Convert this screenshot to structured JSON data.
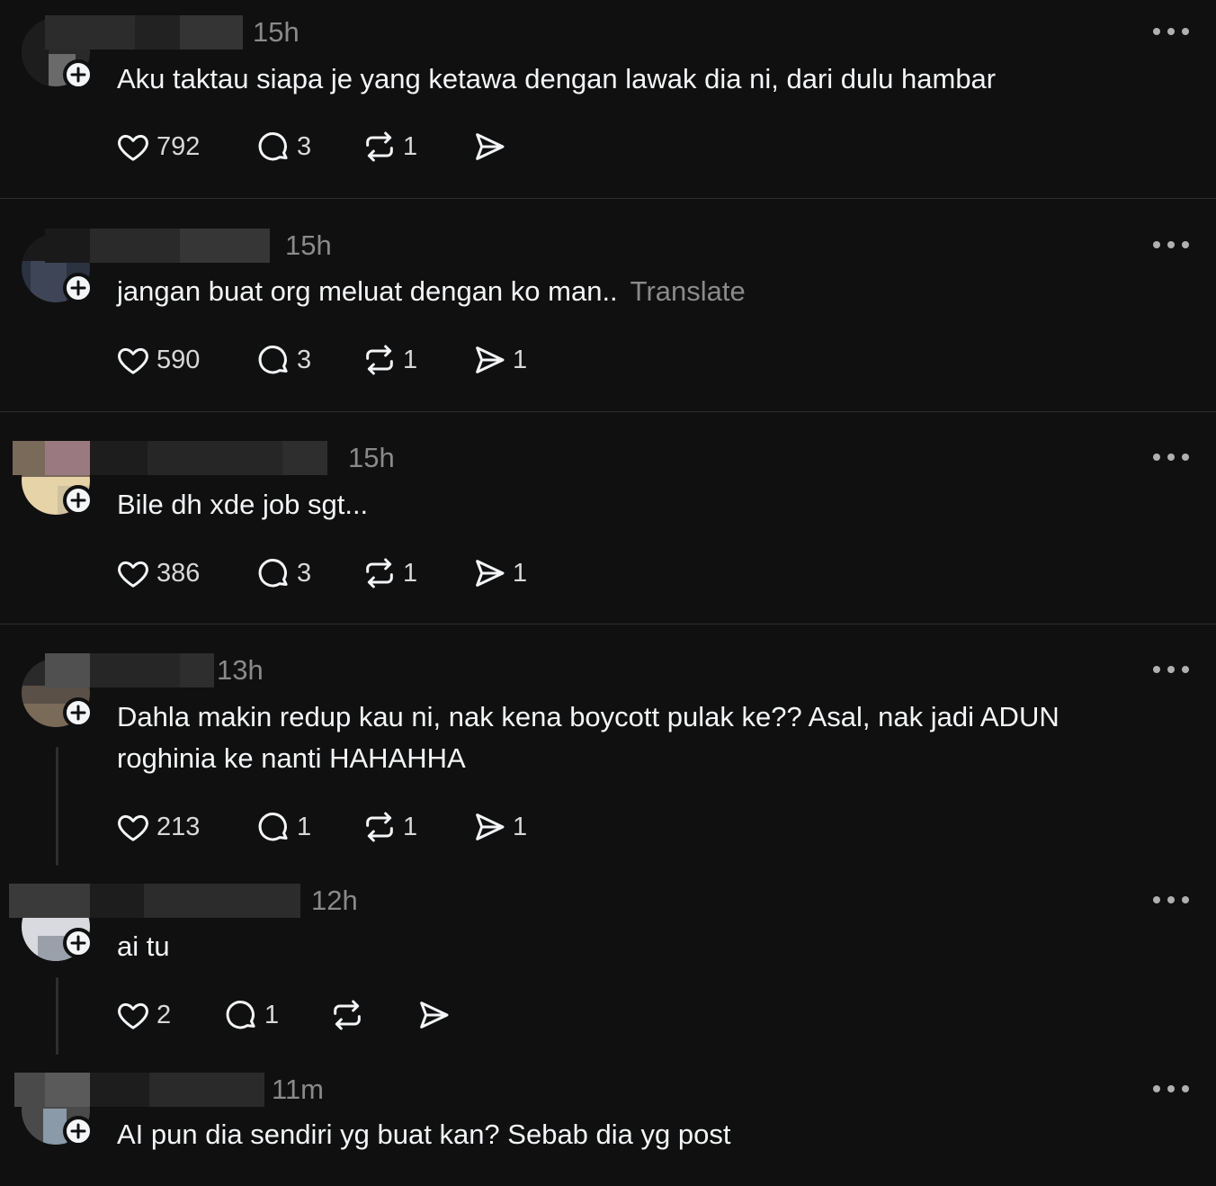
{
  "posts": [
    {
      "time": "15h",
      "text": "Aku taktau siapa je yang ketawa dengan lawak dia ni, dari dulu hambar",
      "translate": "",
      "likes": "792",
      "replies": "3",
      "reposts": "1",
      "shares": ""
    },
    {
      "time": "15h",
      "text": "jangan buat org meluat dengan ko man..",
      "translate": "Translate",
      "likes": "590",
      "replies": "3",
      "reposts": "1",
      "shares": "1"
    },
    {
      "time": "15h",
      "text": "Bile dh xde job sgt...",
      "translate": "",
      "likes": "386",
      "replies": "3",
      "reposts": "1",
      "shares": "1"
    },
    {
      "time": "13h",
      "text": "Dahla makin redup kau ni, nak kena boycott pulak ke?? Asal, nak jadi ADUN roghinia ke nanti HAHAHHA",
      "translate": "",
      "likes": "213",
      "replies": "1",
      "reposts": "1",
      "shares": "1"
    },
    {
      "time": "12h",
      "text": "ai tu",
      "translate": "",
      "likes": "2",
      "replies": "1",
      "reposts": "",
      "shares": ""
    },
    {
      "time": "11m",
      "text": "AI pun dia sendiri yg buat kan? Sebab dia yg post",
      "translate": ""
    }
  ],
  "icons": {
    "like": "heart-icon",
    "reply": "comment-icon",
    "repost": "repost-icon",
    "share": "send-icon",
    "more": "more-options-icon",
    "follow": "plus-icon"
  },
  "colors": {
    "background": "#101010",
    "text": "#f3f5f7",
    "muted": "#8a8a8a",
    "divider": "#2e2e2e"
  }
}
